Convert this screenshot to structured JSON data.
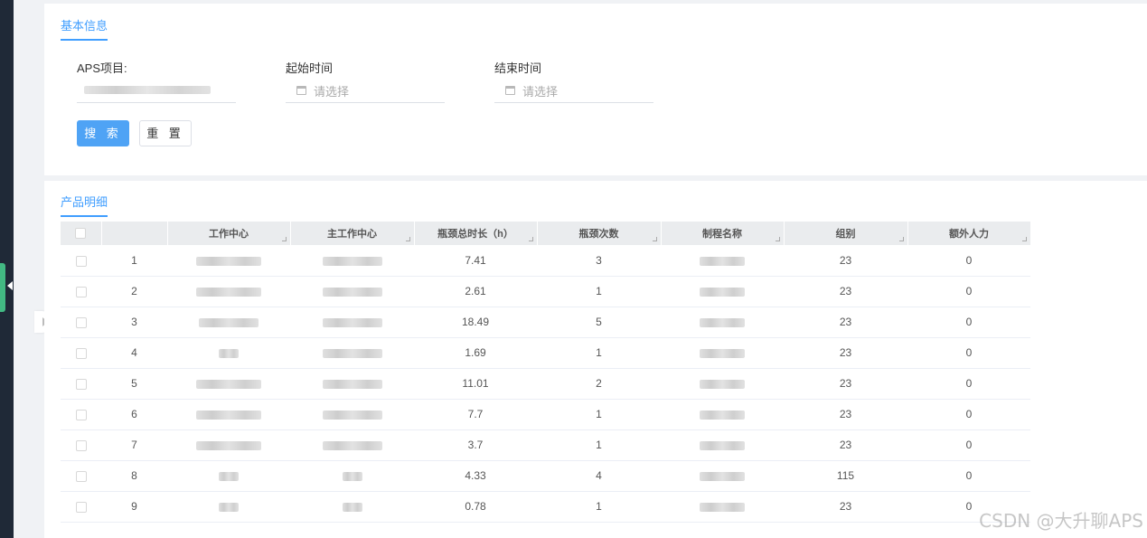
{
  "sections": {
    "basic_info_tab": "基本信息",
    "product_detail_tab": "产品明细"
  },
  "form": {
    "aps_project_label": "APS项目:",
    "start_time_label": "起始时间",
    "end_time_label": "结束时间",
    "start_time_placeholder": "请选择",
    "end_time_placeholder": "请选择",
    "search_button": "搜 索",
    "reset_button": "重 置"
  },
  "table": {
    "headers": {
      "index": "",
      "work_center": "工作中心",
      "main_work_center": "主工作中心",
      "bottleneck_duration": "瓶颈总时长（h）",
      "bottleneck_count": "瓶颈次数",
      "process_name": "制程名称",
      "group": "组别",
      "extra_manpower": "额外人力"
    },
    "rows": [
      {
        "index": "1",
        "bottleneck_duration": "7.41",
        "bottleneck_count": "3",
        "group": "23",
        "extra_manpower": "0"
      },
      {
        "index": "2",
        "bottleneck_duration": "2.61",
        "bottleneck_count": "1",
        "group": "23",
        "extra_manpower": "0"
      },
      {
        "index": "3",
        "bottleneck_duration": "18.49",
        "bottleneck_count": "5",
        "group": "23",
        "extra_manpower": "0"
      },
      {
        "index": "4",
        "bottleneck_duration": "1.69",
        "bottleneck_count": "1",
        "group": "23",
        "extra_manpower": "0"
      },
      {
        "index": "5",
        "bottleneck_duration": "11.01",
        "bottleneck_count": "2",
        "group": "23",
        "extra_manpower": "0"
      },
      {
        "index": "6",
        "bottleneck_duration": "7.7",
        "bottleneck_count": "1",
        "group": "23",
        "extra_manpower": "0"
      },
      {
        "index": "7",
        "bottleneck_duration": "3.7",
        "bottleneck_count": "1",
        "group": "23",
        "extra_manpower": "0"
      },
      {
        "index": "8",
        "bottleneck_duration": "4.33",
        "bottleneck_count": "4",
        "group": "115",
        "extra_manpower": "0"
      },
      {
        "index": "9",
        "bottleneck_duration": "0.78",
        "bottleneck_count": "1",
        "group": "23",
        "extra_manpower": "0"
      }
    ]
  },
  "watermark": "CSDN @大升聊APS",
  "colors": {
    "accent": "#409eff",
    "primary_button": "#4fa3f5",
    "sidebar": "#1f2937",
    "sidebar_active_tab": "#42b983"
  },
  "icons": {
    "date_picker": "calendar-icon",
    "sidebar_toggle": "caret-left-icon",
    "collapse_handle": "caret-right-icon"
  }
}
